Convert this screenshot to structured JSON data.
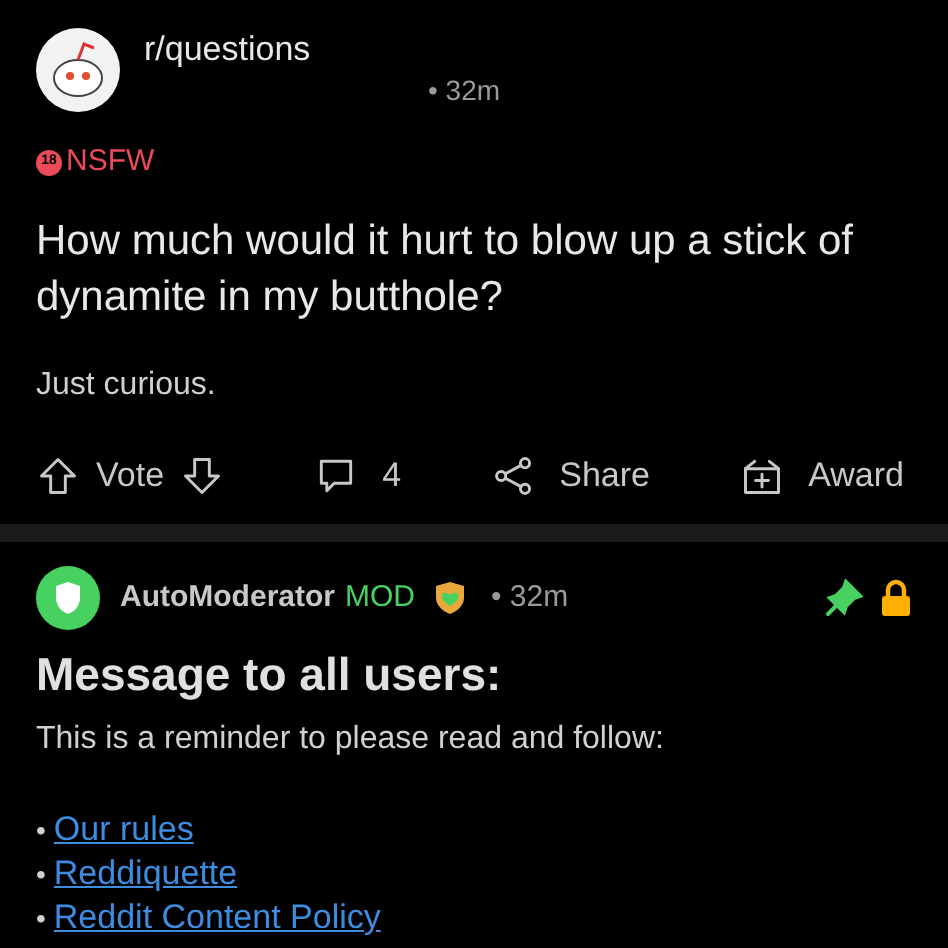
{
  "post": {
    "subreddit": "r/questions",
    "meta": "• 32m",
    "tag": "NSFW",
    "tag_icon": "18",
    "title": "How much would it hurt to blow up a stick of dynamite in my butthole?",
    "body": "Just curious."
  },
  "actions": [
    {
      "kind": "vote",
      "label": "Vote"
    },
    {
      "kind": "comments",
      "label": "4"
    },
    {
      "kind": "share",
      "label": "Share"
    },
    {
      "kind": "award",
      "label": "Award"
    }
  ],
  "comment": {
    "author": "AutoModerator",
    "badge": "MOD",
    "time": "• 32m",
    "pinned": true,
    "locked": true,
    "heading": "Message to all users:",
    "text": "This is a reminder to please read and follow:",
    "links": [
      {
        "bullet": "•",
        "label": "Our rules"
      },
      {
        "bullet": "•",
        "label": "Reddiquette"
      },
      {
        "bullet": "•",
        "label": "Reddit Content Policy"
      }
    ]
  }
}
